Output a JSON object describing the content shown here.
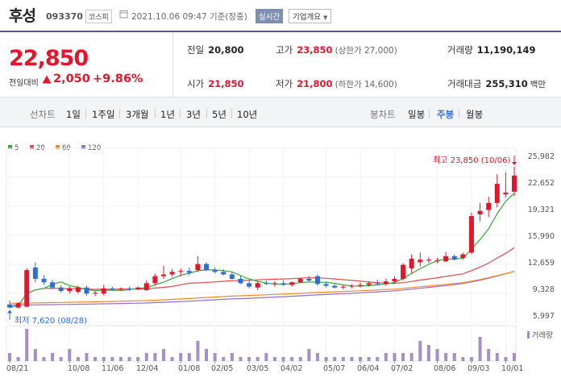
{
  "stock": {
    "name": "후성",
    "code": "093370",
    "market": "코스피",
    "datetime": "2021.10.06 09:47 기준(장중)",
    "realtime_label": "실시간",
    "overview_label": "기업개요"
  },
  "price": {
    "current": "22,850",
    "change_label": "전일대비",
    "change": "2,050",
    "change_pct": "+9.86%"
  },
  "stats": {
    "prev_close_label": "전일",
    "prev_close": "20,800",
    "high_label": "고가",
    "high": "23,850",
    "upper_limit": "(상한가 27,000)",
    "volume_label": "거래량",
    "volume": "11,190,149",
    "open_label": "시가",
    "open": "21,850",
    "low_label": "저가",
    "low": "21,800",
    "lower_limit": "(하한가 14,600)",
    "amount_label": "거래대금",
    "amount": "255,310",
    "amount_unit": "백만"
  },
  "tabs": {
    "line_label": "선차트",
    "line_items": [
      "1일",
      "1주일",
      "3개월",
      "1년",
      "3년",
      "5년",
      "10년"
    ],
    "candle_label": "봉차트",
    "candle_items": [
      "일봉",
      "주봉",
      "월봉"
    ],
    "candle_selected": 1
  },
  "colors": {
    "up": "#e0182d",
    "down": "#2b6fd6",
    "ma5": "#3ea33e",
    "ma20": "#e24c4c",
    "ma60": "#ef8a23",
    "ma120": "#9b6cc9",
    "volume": "#a48fc6",
    "accent": "#3a6fd0"
  },
  "chart_data": {
    "type": "candlestick",
    "legend": [
      "5",
      "20",
      "60",
      "120"
    ],
    "y_ticks": [
      "25,982",
      "22,652",
      "19,321",
      "15,990",
      "12,659",
      "9,328",
      "5,997"
    ],
    "y_tick_values": [
      25982,
      22652,
      19321,
      15990,
      12659,
      9328,
      5997
    ],
    "ylim": [
      5997,
      25982
    ],
    "x_ticks": [
      "08/21",
      "10/08",
      "11/06",
      "12/04",
      "01/08",
      "02/05",
      "03/05",
      "04/02",
      "05/07",
      "06/04",
      "07/02",
      "08/06",
      "09/03",
      "10/01"
    ],
    "x_tick_index": [
      0,
      7,
      11,
      15,
      20,
      24,
      28,
      32,
      37,
      41,
      45,
      50,
      54,
      58
    ],
    "high_annotation": "최고 23,850 (10/06)",
    "low_annotation": "최저 7,620 (08/28)",
    "volume_label": "거래량",
    "candles": [
      {
        "o": 8050,
        "h": 8500,
        "l": 7620,
        "c": 7700
      },
      {
        "o": 7700,
        "h": 8300,
        "l": 7600,
        "c": 8200
      },
      {
        "o": 7800,
        "h": 12200,
        "l": 7700,
        "c": 12000
      },
      {
        "o": 12300,
        "h": 12900,
        "l": 10600,
        "c": 11000
      },
      {
        "o": 11000,
        "h": 11400,
        "l": 10300,
        "c": 10600
      },
      {
        "o": 10600,
        "h": 10900,
        "l": 9800,
        "c": 10000
      },
      {
        "o": 10000,
        "h": 10300,
        "l": 9400,
        "c": 9600
      },
      {
        "o": 9600,
        "h": 10100,
        "l": 9300,
        "c": 9900
      },
      {
        "o": 9500,
        "h": 10200,
        "l": 9300,
        "c": 10000
      },
      {
        "o": 10000,
        "h": 10200,
        "l": 9100,
        "c": 9300
      },
      {
        "o": 9300,
        "h": 9600,
        "l": 9000,
        "c": 9400
      },
      {
        "o": 9300,
        "h": 10300,
        "l": 9100,
        "c": 9900
      },
      {
        "o": 9900,
        "h": 10100,
        "l": 9700,
        "c": 9800
      },
      {
        "o": 9800,
        "h": 10000,
        "l": 9600,
        "c": 9900
      },
      {
        "o": 9900,
        "h": 10100,
        "l": 9600,
        "c": 9800
      },
      {
        "o": 9800,
        "h": 10100,
        "l": 9700,
        "c": 10000
      },
      {
        "o": 9700,
        "h": 10800,
        "l": 9600,
        "c": 10500
      },
      {
        "o": 10500,
        "h": 11600,
        "l": 10200,
        "c": 11300
      },
      {
        "o": 11300,
        "h": 12500,
        "l": 11000,
        "c": 11500
      },
      {
        "o": 11500,
        "h": 12100,
        "l": 11200,
        "c": 11800
      },
      {
        "o": 11800,
        "h": 12200,
        "l": 11300,
        "c": 11900
      },
      {
        "o": 11900,
        "h": 12300,
        "l": 11400,
        "c": 11700
      },
      {
        "o": 12000,
        "h": 13600,
        "l": 11800,
        "c": 12700
      },
      {
        "o": 12700,
        "h": 12900,
        "l": 11900,
        "c": 12000
      },
      {
        "o": 12000,
        "h": 12300,
        "l": 11600,
        "c": 11800
      },
      {
        "o": 11800,
        "h": 12100,
        "l": 11400,
        "c": 11500
      },
      {
        "o": 11500,
        "h": 11800,
        "l": 10900,
        "c": 11000
      },
      {
        "o": 11000,
        "h": 11300,
        "l": 10400,
        "c": 10500
      },
      {
        "o": 10500,
        "h": 10800,
        "l": 9900,
        "c": 10100
      },
      {
        "o": 10000,
        "h": 10700,
        "l": 9700,
        "c": 10500
      },
      {
        "o": 10500,
        "h": 10800,
        "l": 10300,
        "c": 10400
      },
      {
        "o": 10400,
        "h": 10700,
        "l": 10100,
        "c": 10500
      },
      {
        "o": 10500,
        "h": 10800,
        "l": 10200,
        "c": 10300
      },
      {
        "o": 10300,
        "h": 10700,
        "l": 10100,
        "c": 10600
      },
      {
        "o": 10600,
        "h": 11100,
        "l": 10500,
        "c": 11000
      },
      {
        "o": 11000,
        "h": 11300,
        "l": 10600,
        "c": 10800
      },
      {
        "o": 11300,
        "h": 11500,
        "l": 10200,
        "c": 10400
      },
      {
        "o": 10400,
        "h": 10700,
        "l": 10000,
        "c": 10200
      },
      {
        "o": 10200,
        "h": 10400,
        "l": 9900,
        "c": 10000
      },
      {
        "o": 10000,
        "h": 10300,
        "l": 9800,
        "c": 10100
      },
      {
        "o": 10100,
        "h": 10400,
        "l": 9900,
        "c": 10200
      },
      {
        "o": 10200,
        "h": 10600,
        "l": 10000,
        "c": 10300
      },
      {
        "o": 10300,
        "h": 10700,
        "l": 10100,
        "c": 10500
      },
      {
        "o": 10500,
        "h": 10900,
        "l": 10300,
        "c": 10400
      },
      {
        "o": 10400,
        "h": 11000,
        "l": 10200,
        "c": 10700
      },
      {
        "o": 10700,
        "h": 11300,
        "l": 10500,
        "c": 11000
      },
      {
        "o": 11000,
        "h": 12800,
        "l": 10800,
        "c": 12600
      },
      {
        "o": 12200,
        "h": 13800,
        "l": 11600,
        "c": 13300
      },
      {
        "o": 12900,
        "h": 14000,
        "l": 12400,
        "c": 13200
      },
      {
        "o": 13100,
        "h": 13500,
        "l": 12800,
        "c": 13200
      },
      {
        "o": 13000,
        "h": 13400,
        "l": 12800,
        "c": 13100
      },
      {
        "o": 13000,
        "h": 14100,
        "l": 12900,
        "c": 13600
      },
      {
        "o": 13600,
        "h": 13800,
        "l": 13100,
        "c": 13200
      },
      {
        "o": 13400,
        "h": 14000,
        "l": 13200,
        "c": 13800
      },
      {
        "o": 14000,
        "h": 18600,
        "l": 13800,
        "c": 18200
      },
      {
        "o": 18400,
        "h": 19700,
        "l": 17600,
        "c": 18800
      },
      {
        "o": 18900,
        "h": 20400,
        "l": 18100,
        "c": 19700
      },
      {
        "o": 19700,
        "h": 23000,
        "l": 19200,
        "c": 21900
      },
      {
        "o": 20700,
        "h": 23200,
        "l": 20300,
        "c": 20900
      },
      {
        "o": 21000,
        "h": 23850,
        "l": 20500,
        "c": 22850
      }
    ],
    "volume": [
      2,
      1,
      8,
      3,
      1,
      2,
      1,
      3,
      1,
      2,
      1,
      1,
      1,
      1,
      1,
      1,
      2,
      2,
      3,
      1,
      2,
      2,
      5,
      3,
      2,
      1,
      2,
      1,
      1,
      1,
      2,
      1,
      1,
      1,
      1,
      3,
      2,
      1,
      1,
      1,
      1,
      1,
      1,
      1,
      2,
      2,
      2,
      2,
      5,
      4,
      3,
      2,
      2,
      1,
      1,
      6,
      3,
      2,
      1,
      2
    ]
  }
}
